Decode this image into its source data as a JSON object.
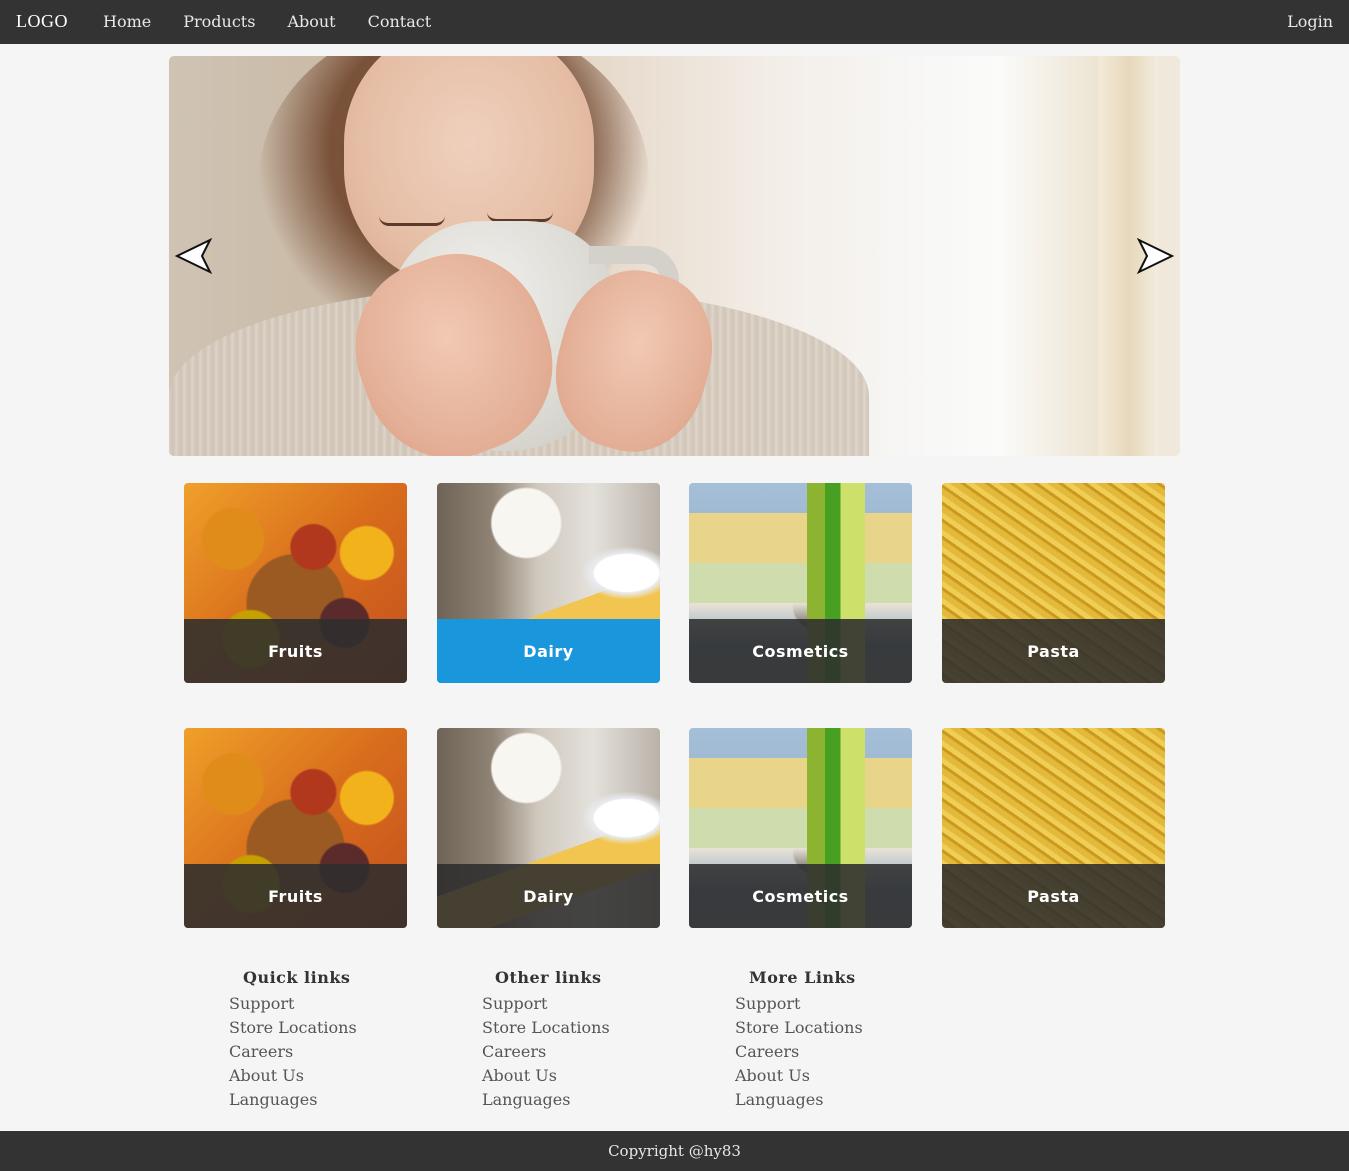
{
  "nav": {
    "logo": "LOGO",
    "items": [
      "Home",
      "Products",
      "About",
      "Contact"
    ],
    "login": "Login"
  },
  "hero": {
    "prev_icon": "arrow-left-icon",
    "next_icon": "arrow-right-icon"
  },
  "categories_row1": [
    {
      "label": "Fruits",
      "active": false
    },
    {
      "label": "Dairy",
      "active": true
    },
    {
      "label": "Cosmetics",
      "active": false
    },
    {
      "label": "Pasta",
      "active": false
    }
  ],
  "categories_row2": [
    {
      "label": "Fruits",
      "active": false
    },
    {
      "label": "Dairy",
      "active": false
    },
    {
      "label": "Cosmetics",
      "active": false
    },
    {
      "label": "Pasta",
      "active": false
    }
  ],
  "footer_columns": [
    {
      "title": "Quick links",
      "links": [
        "Support",
        "Store Locations",
        "Careers",
        "About Us",
        "Languages"
      ]
    },
    {
      "title": "Other links",
      "links": [
        "Support",
        "Store Locations",
        "Careers",
        "About Us",
        "Languages"
      ]
    },
    {
      "title": "More Links",
      "links": [
        "Support",
        "Store Locations",
        "Careers",
        "About Us",
        "Languages"
      ]
    }
  ],
  "copyright": "Copyright @hy83",
  "colors": {
    "nav_bg": "#333333",
    "page_bg": "#f5f5f5",
    "active_caption": "#1a96dc",
    "caption_bg": "#2d2d2d"
  }
}
